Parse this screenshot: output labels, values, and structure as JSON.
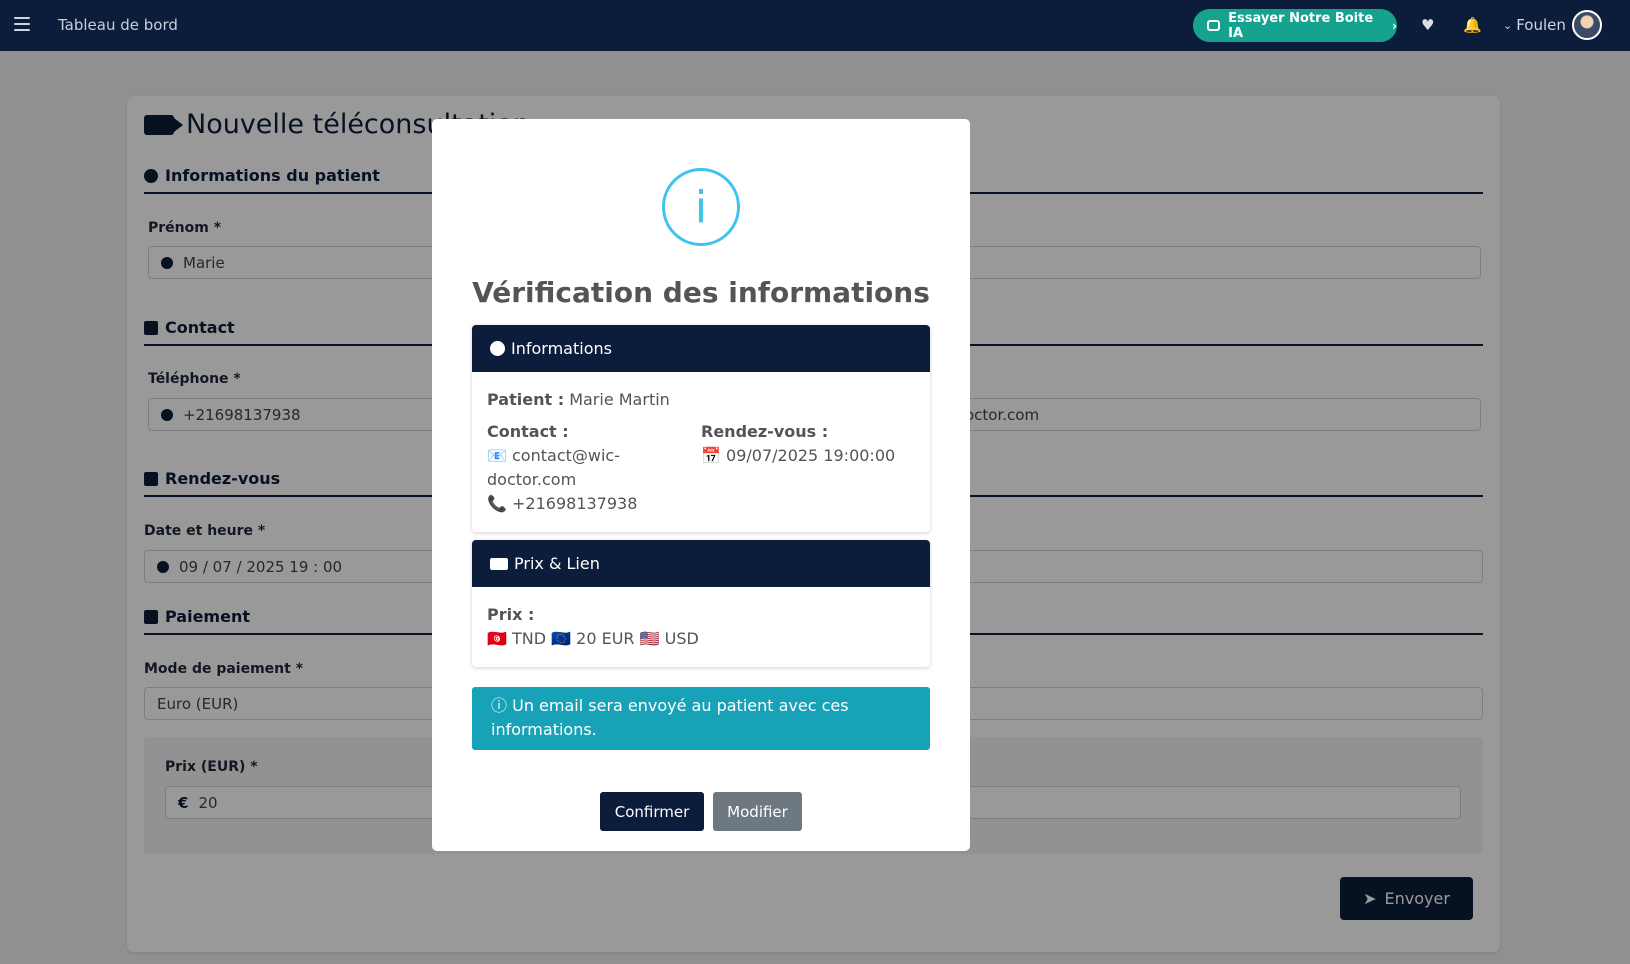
{
  "navbar": {
    "title": "Tableau de bord",
    "ai_button": "Essayer Notre Boite IA",
    "user_name": "Foulen"
  },
  "form": {
    "page_title": "Nouvelle téléconsultation",
    "sections": {
      "patient": "Informations du patient",
      "contact": "Contact",
      "appointment": "Rendez-vous",
      "payment": "Paiement"
    },
    "fields": {
      "first_name_label": "Prénom *",
      "first_name_value": "Marie",
      "phone_label": "Téléphone *",
      "phone_value": "+21698137938",
      "email_value_partial": "octor.com",
      "datetime_label": "Date et heure *",
      "datetime_value": "09 / 07 / 2025  19 : 00",
      "payment_mode_label": "Mode de paiement *",
      "payment_mode_value": "Euro (EUR)",
      "price_label": "Prix (EUR) *",
      "price_value": "20",
      "currency_symbol": "€"
    },
    "send_button": "Envoyer"
  },
  "modal": {
    "icon": "i",
    "title": "Vérification des informations",
    "info_panel": {
      "header": "Informations",
      "patient_label": "Patient :",
      "patient_value": "Marie Martin",
      "contact_label": "Contact :",
      "contact_email": "📧 contact@wic-doctor.com",
      "contact_phone": "📞 +21698137938",
      "appointment_label": "Rendez-vous :",
      "appointment_value": "📅 09/07/2025 19:00:00"
    },
    "price_panel": {
      "header": "Prix & Lien",
      "price_label": "Prix :",
      "price_value": "🇹🇳 TND 🇪🇺 20 EUR 🇺🇸 USD"
    },
    "alert": "Un email sera envoyé au patient avec ces informations.",
    "confirm_button": "Confirmer",
    "modify_button": "Modifier"
  },
  "colors": {
    "navy": "#0b1d3a",
    "teal": "#15a38f",
    "info": "#17a2b8",
    "info_icon": "#3fc3ee",
    "secondary": "#6e7881"
  }
}
